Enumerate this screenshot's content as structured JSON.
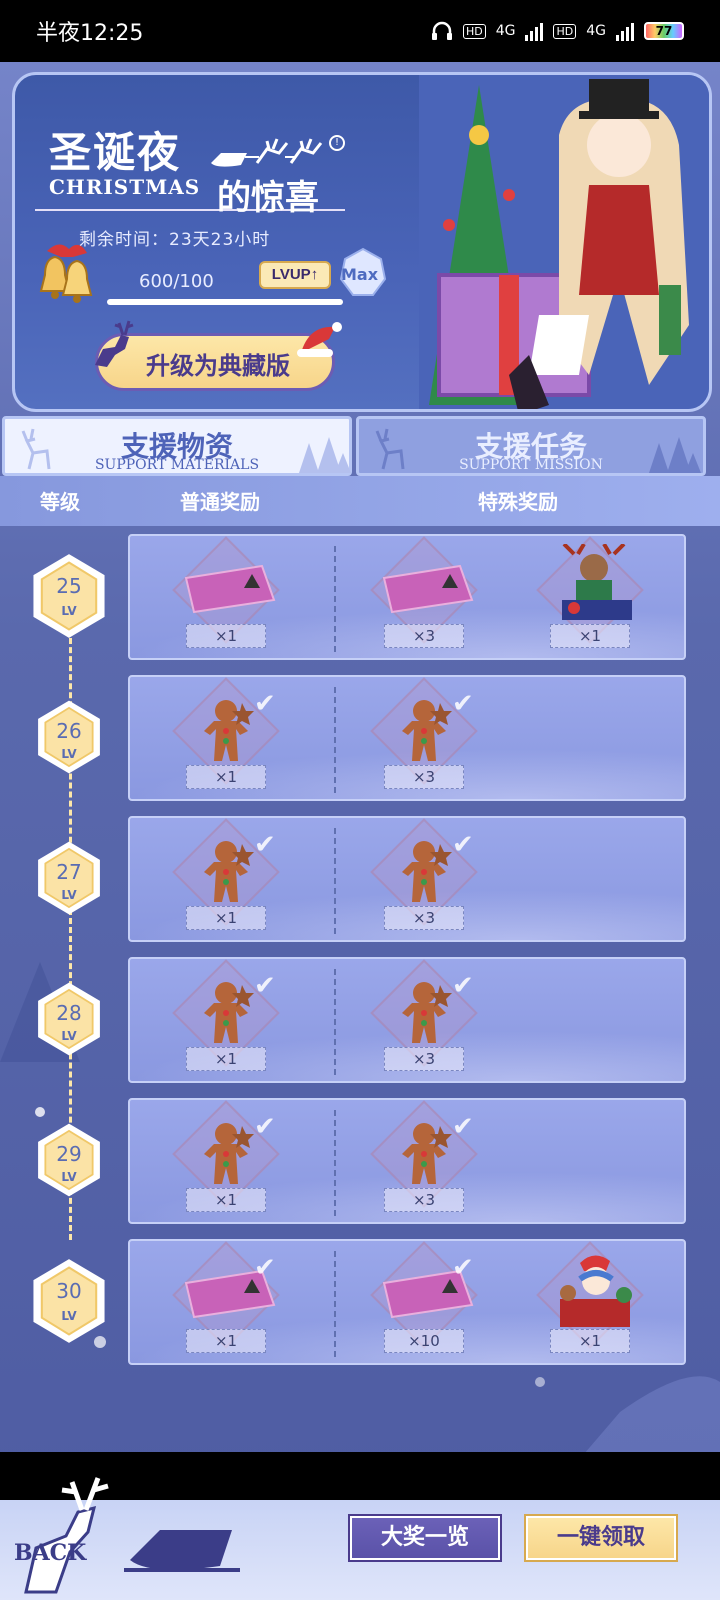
{
  "status_bar": {
    "time": "半夜12:25",
    "network1": "4G",
    "network2": "4G",
    "hd1": "HD",
    "hd2": "HD",
    "battery": "77"
  },
  "banner": {
    "title_cn": "圣诞夜",
    "title_en": "CHRISTMAS",
    "title_cn2": "的惊喜",
    "time_left": "剩余时间：23天23小时",
    "exp": "600/100",
    "lvup_label": "LVUP↑",
    "max_label": "Max",
    "upgrade_label": "升级为典藏版"
  },
  "tabs": [
    {
      "cn": "支援物资",
      "en": "SUPPORT MATERIALS"
    },
    {
      "cn": "支援任务",
      "en": "SUPPORT MISSION"
    }
  ],
  "header": {
    "level": "等级",
    "normal_reward": "普通奖励",
    "special_reward": "特殊奖励"
  },
  "level_suffix": "LV",
  "rows": [
    {
      "level": "25",
      "normal_qty": "×1",
      "special1_qty": "×3",
      "special2_qty": "×1",
      "normal_item": "ticket",
      "special1_item": "ticket",
      "special2_item": "reindeer-figure",
      "claimed": false
    },
    {
      "level": "26",
      "normal_qty": "×1",
      "special1_qty": "×3",
      "normal_item": "gingerbread",
      "special1_item": "gingerbread",
      "claimed": true
    },
    {
      "level": "27",
      "normal_qty": "×1",
      "special1_qty": "×3",
      "normal_item": "gingerbread",
      "special1_item": "gingerbread",
      "claimed": true
    },
    {
      "level": "28",
      "normal_qty": "×1",
      "special1_qty": "×3",
      "normal_item": "gingerbread",
      "special1_item": "gingerbread",
      "claimed": true
    },
    {
      "level": "29",
      "normal_qty": "×1",
      "special1_qty": "×3",
      "normal_item": "gingerbread",
      "special1_item": "gingerbread",
      "claimed": true
    },
    {
      "level": "30",
      "normal_qty": "×1",
      "special1_qty": "×10",
      "special2_qty": "×1",
      "normal_item": "ticket",
      "special1_item": "ticket",
      "special2_item": "christmas-character",
      "claimed": true
    }
  ],
  "bottom": {
    "back_label": "BACK",
    "prize_list": "大奖一览",
    "claim_all": "一键领取"
  },
  "colors": {
    "accent": "#5a69ad",
    "gold": "#fde7a8",
    "purple": "#4a3b8c"
  }
}
